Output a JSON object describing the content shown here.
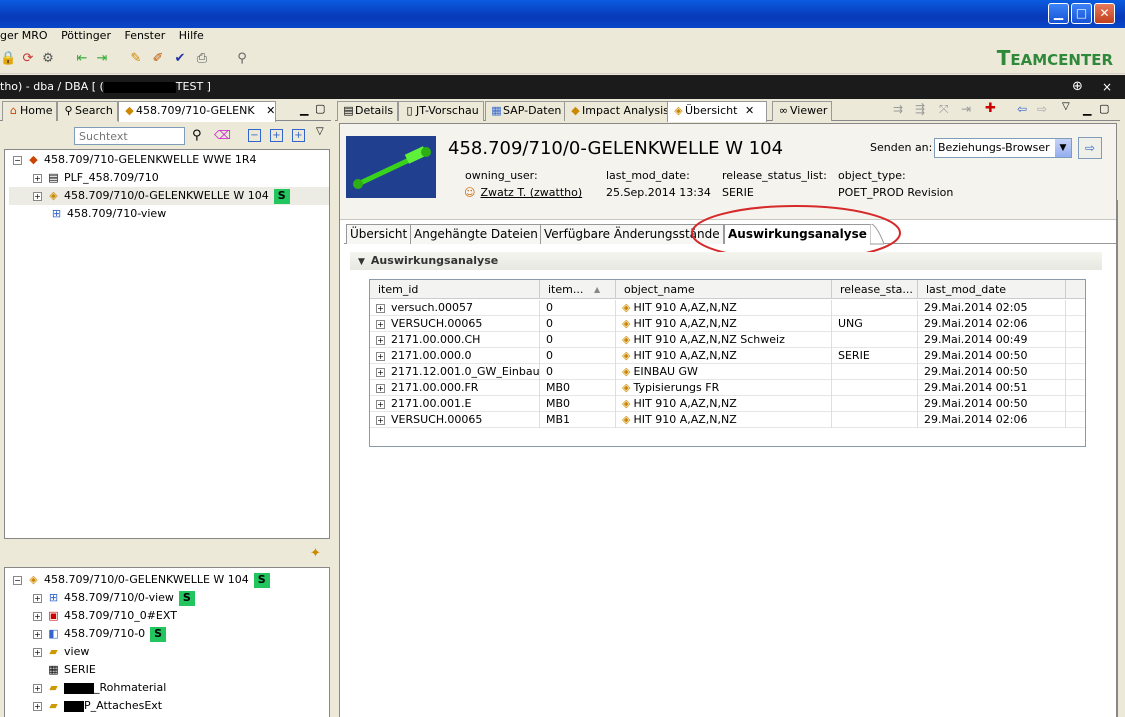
{
  "menu": [
    "ger MRO",
    "Pöttinger",
    "Fenster",
    "Hilfe"
  ],
  "brand": {
    "big": "T",
    "rest": "EAMCENTER",
    "color": "#2e8a3a"
  },
  "status": {
    "prefix": "tho) - dba / DBA   [ (",
    "suffix": "TEST ]"
  },
  "left_tabs": [
    {
      "label": "Home",
      "icon": "home-icon"
    },
    {
      "label": "Search",
      "icon": "search-icon"
    },
    {
      "label": "458.709/710-GELENK",
      "icon": "item-icon"
    }
  ],
  "search": {
    "placeholder": "Suchtext"
  },
  "top_tree": [
    {
      "label": "458.709/710-GELENKWELLE WWE 1R4",
      "indent": 0,
      "exp": "−",
      "badge": ""
    },
    {
      "label": "PLF_458.709/710",
      "indent": 1,
      "exp": "+",
      "badge": ""
    },
    {
      "label": "458.709/710/0-GELENKWELLE W 104",
      "indent": 1,
      "exp": "+",
      "badge": "S"
    },
    {
      "label": "458.709/710-view",
      "indent": 1,
      "exp": "",
      "badge": ""
    }
  ],
  "bottom_tree": [
    {
      "label": "458.709/710/0-GELENKWELLE W 104",
      "indent": 0,
      "exp": "−",
      "badge": "S"
    },
    {
      "label": "458.709/710/0-view",
      "indent": 1,
      "exp": "+",
      "badge": "S"
    },
    {
      "label": "458.709/710_0#EXT",
      "indent": 1,
      "exp": "+",
      "badge": ""
    },
    {
      "label": "458.709/710-0",
      "indent": 1,
      "exp": "+",
      "badge": "S"
    },
    {
      "label": "view",
      "indent": 1,
      "exp": "+",
      "badge": ""
    },
    {
      "label": "SERIE",
      "indent": 1,
      "exp": "",
      "badge": ""
    },
    {
      "label": "_Rohmaterial",
      "indent": 1,
      "exp": "+",
      "badge": ""
    },
    {
      "label": "P_AttachesExt",
      "indent": 1,
      "exp": "+",
      "badge": ""
    }
  ],
  "right_tabs": [
    {
      "label": "Details"
    },
    {
      "label": "JT-Vorschau"
    },
    {
      "label": "SAP-Daten"
    },
    {
      "label": "Impact Analysis"
    },
    {
      "label": "Übersicht"
    },
    {
      "label": "Viewer"
    }
  ],
  "header": {
    "title": "458.709/710/0-GELENKWELLE W 104",
    "send_label": "Senden an:",
    "send_value": "Beziehungs-Browser",
    "fields": [
      {
        "label": "owning_user:",
        "value": "Zwatz T. (zwattho)"
      },
      {
        "label": "last_mod_date:",
        "value": "25.Sep.2014 13:34"
      },
      {
        "label": "release_status_list:",
        "value": "SERIE"
      },
      {
        "label": "object_type:",
        "value": "POET_PROD Revision"
      }
    ]
  },
  "sub_tabs": [
    "Übersicht",
    "Angehängte Dateien",
    "Verfügbare Änderungsstände",
    "Auswirkungsanalyse"
  ],
  "section_title": "Auswirkungsanalyse",
  "grid": {
    "columns": [
      "item_id",
      "item...",
      "object_name",
      "release_sta...",
      "last_mod_date"
    ],
    "rows": [
      [
        "versuch.00057",
        "0",
        "HIT 910 A,AZ,N,NZ",
        "",
        "29.Mai.2014 02:05"
      ],
      [
        "VERSUCH.00065",
        "0",
        "HIT 910 A,AZ,N,NZ",
        "UNG",
        "29.Mai.2014 02:06"
      ],
      [
        "2171.00.000.CH",
        "0",
        "HIT 910 A,AZ,N,NZ Schweiz",
        "",
        "29.Mai.2014 00:49"
      ],
      [
        "2171.00.000.0",
        "0",
        "HIT 910 A,AZ,N,NZ",
        "SERIE",
        "29.Mai.2014 00:50"
      ],
      [
        "2171.12.001.0_GW_Einbau",
        "0",
        "EINBAU GW",
        "",
        "29.Mai.2014 00:50"
      ],
      [
        "2171.00.000.FR",
        "MB0",
        "Typisierungs FR",
        "",
        "29.Mai.2014 00:51"
      ],
      [
        "2171.00.001.E",
        "MB0",
        "HIT 910 A,AZ,N,NZ",
        "",
        "29.Mai.2014 00:50"
      ],
      [
        "VERSUCH.00065",
        "MB1",
        "HIT 910 A,AZ,N,NZ",
        "",
        "29.Mai.2014 02:06"
      ]
    ]
  },
  "colors": {
    "accent_green": "#22c55e",
    "highlight_red": "#d62a2a",
    "status_bar": "#1b1b1b"
  }
}
